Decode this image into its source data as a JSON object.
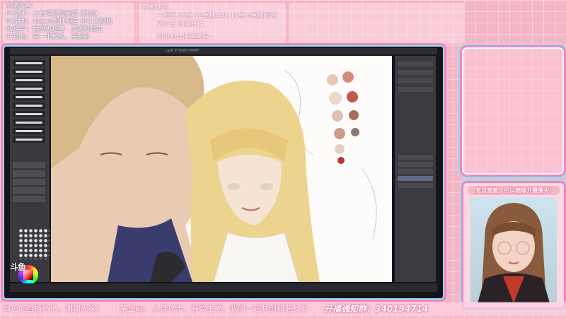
{
  "info_left": {
    "title": "主播装备：",
    "lines": [
      "PC端手：大台湾五核美蓝 (数位)",
      "PC端机：Ibeam配件相连 (PCIC新版)",
      "PE端手：数位板超薄 - 无线形稳定",
      "PE端机：同一平板系，已配好"
    ]
  },
  "info_mid": {
    "title": "直播时间：",
    "line1": "一到五 15点 18点播单机 10点 0点播网游",
    "line2": "周六日 随缘开播",
    "line3": "偶尔也会播画画呀~"
  },
  "software": {
    "title": "CLIP STUDIO PAINT"
  },
  "brand": {
    "logo": "斗鱼"
  },
  "camera": {
    "banner": "有点害羞，所以随缘开摄像头!"
  },
  "ticker": {
    "message": "绿色的直播环境，谢谢大家！　　禁止ky、人身攻击、辱骂主播，我们一起共创和谐友爱",
    "qq_label": "开播通知群：",
    "qq_number": "340194714"
  },
  "palette_colors": [
    "#e8c7b9",
    "#d98b7a",
    "#edd8cc",
    "#c2574b",
    "#dcc1b2",
    "#a86d5a",
    "#c79c8a",
    "#8a7a72",
    "#e4cfc6",
    "#b23a2a"
  ],
  "colors": {
    "accent_pink": "#ff7fbf",
    "accent_cyan": "#7fe9f4",
    "background": "#f4b6c6"
  }
}
